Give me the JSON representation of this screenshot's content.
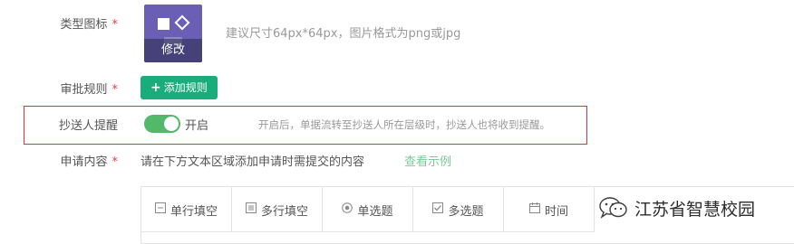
{
  "icon_field": {
    "label": "类型图标",
    "required_mark": "*",
    "edit_label": "修改",
    "hint": "建议尺寸64px*64px，图片格式为png或jpg"
  },
  "approval_rules": {
    "label": "审批规则",
    "required_mark": "*",
    "add_button": "添加规则",
    "plus_icon": "+"
  },
  "cc_reminder": {
    "label": "抄送人提醒",
    "toggle_state": "开启",
    "description": "开启后，单据流转至抄送人所在层级时，抄送人也将收到提醒。",
    "toggle_on": true
  },
  "request_content": {
    "label": "申请内容",
    "required_mark": "*",
    "instruction": "请在下方文本区域添加申请时需提交的内容",
    "example_link": "查看示例"
  },
  "widgets": [
    {
      "label": "单行填空",
      "icon": "single-line-icon"
    },
    {
      "label": "多行填空",
      "icon": "multi-line-icon"
    },
    {
      "label": "单选题",
      "icon": "radio-icon"
    },
    {
      "label": "多选题",
      "icon": "checkbox-icon"
    },
    {
      "label": "时间",
      "icon": "calendar-icon"
    }
  ],
  "watermark": {
    "text": "江苏省智慧校园"
  },
  "colors": {
    "accent_green": "#1aad7c",
    "toggle_green": "#52b86a",
    "highlight_red": "#d9343b",
    "icon_purple": "#6b5fb5",
    "link_green": "#7cc89a"
  }
}
